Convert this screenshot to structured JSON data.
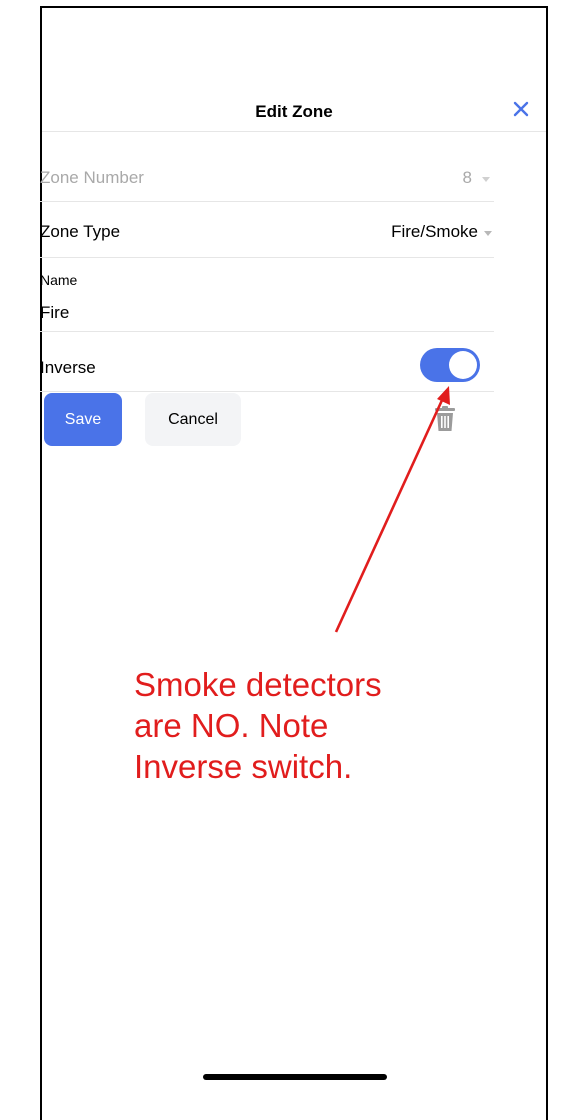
{
  "header": {
    "title": "Edit Zone"
  },
  "fields": {
    "zone_number": {
      "label": "Zone Number",
      "value": "8"
    },
    "zone_type": {
      "label": "Zone Type",
      "value": "Fire/Smoke"
    },
    "name": {
      "label": "Name",
      "value": "Fire"
    },
    "inverse": {
      "label": "Inverse",
      "enabled": true
    }
  },
  "actions": {
    "save_label": "Save",
    "cancel_label": "Cancel"
  },
  "annotation": {
    "line1": "Smoke detectors",
    "line2": "are NO. Note",
    "line3": "Inverse switch."
  },
  "colors": {
    "accent": "#4a73e8",
    "annotation": "#e11d1d",
    "muted": "#a9a9a9"
  },
  "icons": {
    "close": "close-icon",
    "trash": "trash-icon",
    "dropdown": "chevron-down-icon"
  }
}
